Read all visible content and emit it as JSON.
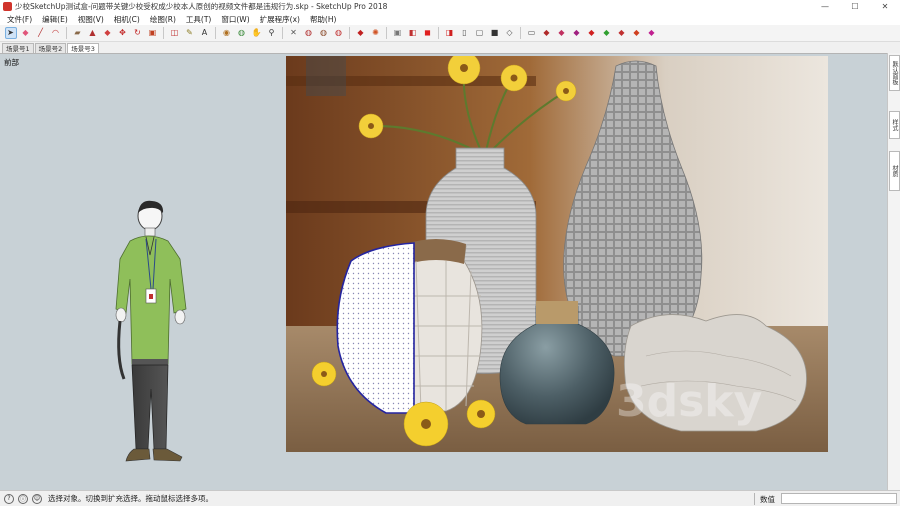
{
  "window": {
    "title": "少校SketchUp测试盒-问题带关键少校受权成少校本人原创的视频文件都是违规行为.skp - SketchUp Pro 2018",
    "minimize": "—",
    "maximize": "☐",
    "close": "✕"
  },
  "menu": [
    "文件(F)",
    "编辑(E)",
    "视图(V)",
    "相机(C)",
    "绘图(R)",
    "工具(T)",
    "窗口(W)",
    "扩展程序(x)",
    "帮助(H)"
  ],
  "toolbar": {
    "icons": [
      {
        "name": "select-icon",
        "glyph": "➤",
        "color": "#333333"
      },
      {
        "name": "eraser-icon",
        "glyph": "◆",
        "color": "#e0557a"
      },
      {
        "name": "pencil-line-icon",
        "glyph": "╱",
        "color": "#b02a2a"
      },
      {
        "name": "arc-icon",
        "glyph": "◠",
        "color": "#c03030"
      },
      {
        "name": "shape-icon",
        "glyph": "▰",
        "color": "#8a6a4a"
      },
      {
        "name": "push-pull-icon",
        "glyph": "▲",
        "color": "#b03030"
      },
      {
        "name": "follow-me-icon",
        "glyph": "◆",
        "color": "#d04040"
      },
      {
        "name": "move-icon",
        "glyph": "✥",
        "color": "#c02020"
      },
      {
        "name": "rotate-icon",
        "glyph": "↻",
        "color": "#c02020"
      },
      {
        "name": "scale-icon",
        "glyph": "▣",
        "color": "#c04020"
      },
      {
        "name": "offset-icon",
        "glyph": "◫",
        "color": "#c03030"
      },
      {
        "name": "tape-measure-icon",
        "glyph": "✎",
        "color": "#8a7a20"
      },
      {
        "name": "text-icon",
        "glyph": "A",
        "color": "#333333"
      },
      {
        "name": "paint-bucket-icon",
        "glyph": "◉",
        "color": "#b07020"
      },
      {
        "name": "orbit-icon",
        "glyph": "◍",
        "color": "#3a8a3a"
      },
      {
        "name": "pan-icon",
        "glyph": "✋",
        "color": "#c08030"
      },
      {
        "name": "zoom-icon",
        "glyph": "⚲",
        "color": "#333333"
      },
      {
        "name": "zoom-extents-icon",
        "glyph": "✕",
        "color": "#555555"
      },
      {
        "name": "warehouse-icon",
        "glyph": "◍",
        "color": "#b03030"
      },
      {
        "name": "components-icon",
        "glyph": "◍",
        "color": "#8a4a2a"
      },
      {
        "name": "extension-warehouse-icon",
        "glyph": "◍",
        "color": "#c03030"
      },
      {
        "name": "send-to-layout-icon",
        "glyph": "◆",
        "color": "#c02020"
      },
      {
        "name": "settings-gear-icon",
        "glyph": "✺",
        "color": "#d05020"
      },
      {
        "name": "camera-icon",
        "glyph": "▣",
        "color": "#777777"
      },
      {
        "name": "section-plane-icon",
        "glyph": "◧",
        "color": "#c03030"
      },
      {
        "name": "section-display-icon",
        "glyph": "◼",
        "color": "#e02020"
      },
      {
        "name": "section-cut-icon",
        "glyph": "◨",
        "color": "#d02020"
      },
      {
        "name": "iso-view-icon",
        "glyph": "▯",
        "color": "#555555"
      },
      {
        "name": "top-view-icon",
        "glyph": "▢",
        "color": "#555555"
      },
      {
        "name": "front-view-icon",
        "glyph": "■",
        "color": "#333333"
      },
      {
        "name": "right-view-icon",
        "glyph": "◇",
        "color": "#555555"
      },
      {
        "name": "back-view-icon",
        "glyph": "▭",
        "color": "#555555"
      },
      {
        "name": "xray-style-icon",
        "glyph": "◆",
        "color": "#b02a2a"
      },
      {
        "name": "back-edges-style-icon",
        "glyph": "◆",
        "color": "#c03060"
      },
      {
        "name": "wireframe-style-icon",
        "glyph": "◆",
        "color": "#a02080"
      },
      {
        "name": "hidden-line-style-icon",
        "glyph": "◆",
        "color": "#d02020"
      },
      {
        "name": "shaded-style-icon",
        "glyph": "◆",
        "color": "#30a030"
      },
      {
        "name": "textured-style-icon",
        "glyph": "◆",
        "color": "#c03030"
      },
      {
        "name": "monochrome-style-icon",
        "glyph": "◆",
        "color": "#d04020"
      },
      {
        "name": "style-extra-icon",
        "glyph": "◆",
        "color": "#c02090"
      }
    ]
  },
  "scenes": [
    "场景号1",
    "场景号2",
    "场景号3"
  ],
  "viewport": {
    "label": "前部"
  },
  "side_tabs": [
    "默认面板",
    "样式",
    "材质"
  ],
  "status": {
    "help_icon": "?",
    "info_icon": "ⓘ",
    "user_icon": "☺",
    "message": "选择对象。切换到扩充选择。拖动鼠标选择多项。",
    "measure_label": "数值",
    "measure_value": ""
  }
}
